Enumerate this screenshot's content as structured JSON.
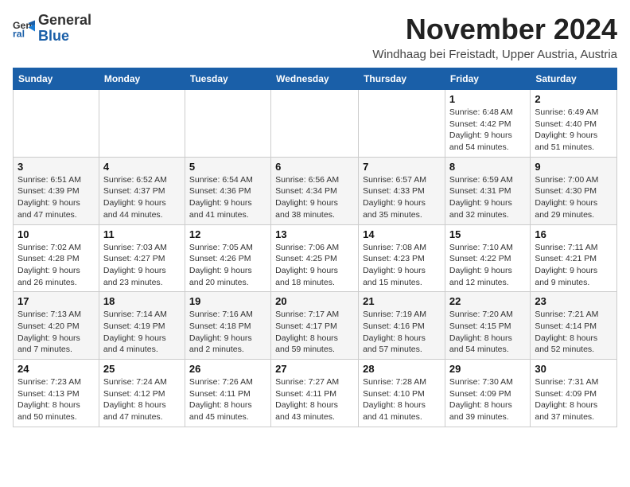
{
  "logo": {
    "general": "General",
    "blue": "Blue"
  },
  "header": {
    "month": "November 2024",
    "location": "Windhaag bei Freistadt, Upper Austria, Austria"
  },
  "days_of_week": [
    "Sunday",
    "Monday",
    "Tuesday",
    "Wednesday",
    "Thursday",
    "Friday",
    "Saturday"
  ],
  "weeks": [
    [
      {
        "day": "",
        "info": ""
      },
      {
        "day": "",
        "info": ""
      },
      {
        "day": "",
        "info": ""
      },
      {
        "day": "",
        "info": ""
      },
      {
        "day": "",
        "info": ""
      },
      {
        "day": "1",
        "info": "Sunrise: 6:48 AM\nSunset: 4:42 PM\nDaylight: 9 hours\nand 54 minutes."
      },
      {
        "day": "2",
        "info": "Sunrise: 6:49 AM\nSunset: 4:40 PM\nDaylight: 9 hours\nand 51 minutes."
      }
    ],
    [
      {
        "day": "3",
        "info": "Sunrise: 6:51 AM\nSunset: 4:39 PM\nDaylight: 9 hours\nand 47 minutes."
      },
      {
        "day": "4",
        "info": "Sunrise: 6:52 AM\nSunset: 4:37 PM\nDaylight: 9 hours\nand 44 minutes."
      },
      {
        "day": "5",
        "info": "Sunrise: 6:54 AM\nSunset: 4:36 PM\nDaylight: 9 hours\nand 41 minutes."
      },
      {
        "day": "6",
        "info": "Sunrise: 6:56 AM\nSunset: 4:34 PM\nDaylight: 9 hours\nand 38 minutes."
      },
      {
        "day": "7",
        "info": "Sunrise: 6:57 AM\nSunset: 4:33 PM\nDaylight: 9 hours\nand 35 minutes."
      },
      {
        "day": "8",
        "info": "Sunrise: 6:59 AM\nSunset: 4:31 PM\nDaylight: 9 hours\nand 32 minutes."
      },
      {
        "day": "9",
        "info": "Sunrise: 7:00 AM\nSunset: 4:30 PM\nDaylight: 9 hours\nand 29 minutes."
      }
    ],
    [
      {
        "day": "10",
        "info": "Sunrise: 7:02 AM\nSunset: 4:28 PM\nDaylight: 9 hours\nand 26 minutes."
      },
      {
        "day": "11",
        "info": "Sunrise: 7:03 AM\nSunset: 4:27 PM\nDaylight: 9 hours\nand 23 minutes."
      },
      {
        "day": "12",
        "info": "Sunrise: 7:05 AM\nSunset: 4:26 PM\nDaylight: 9 hours\nand 20 minutes."
      },
      {
        "day": "13",
        "info": "Sunrise: 7:06 AM\nSunset: 4:25 PM\nDaylight: 9 hours\nand 18 minutes."
      },
      {
        "day": "14",
        "info": "Sunrise: 7:08 AM\nSunset: 4:23 PM\nDaylight: 9 hours\nand 15 minutes."
      },
      {
        "day": "15",
        "info": "Sunrise: 7:10 AM\nSunset: 4:22 PM\nDaylight: 9 hours\nand 12 minutes."
      },
      {
        "day": "16",
        "info": "Sunrise: 7:11 AM\nSunset: 4:21 PM\nDaylight: 9 hours\nand 9 minutes."
      }
    ],
    [
      {
        "day": "17",
        "info": "Sunrise: 7:13 AM\nSunset: 4:20 PM\nDaylight: 9 hours\nand 7 minutes."
      },
      {
        "day": "18",
        "info": "Sunrise: 7:14 AM\nSunset: 4:19 PM\nDaylight: 9 hours\nand 4 minutes."
      },
      {
        "day": "19",
        "info": "Sunrise: 7:16 AM\nSunset: 4:18 PM\nDaylight: 9 hours\nand 2 minutes."
      },
      {
        "day": "20",
        "info": "Sunrise: 7:17 AM\nSunset: 4:17 PM\nDaylight: 8 hours\nand 59 minutes."
      },
      {
        "day": "21",
        "info": "Sunrise: 7:19 AM\nSunset: 4:16 PM\nDaylight: 8 hours\nand 57 minutes."
      },
      {
        "day": "22",
        "info": "Sunrise: 7:20 AM\nSunset: 4:15 PM\nDaylight: 8 hours\nand 54 minutes."
      },
      {
        "day": "23",
        "info": "Sunrise: 7:21 AM\nSunset: 4:14 PM\nDaylight: 8 hours\nand 52 minutes."
      }
    ],
    [
      {
        "day": "24",
        "info": "Sunrise: 7:23 AM\nSunset: 4:13 PM\nDaylight: 8 hours\nand 50 minutes."
      },
      {
        "day": "25",
        "info": "Sunrise: 7:24 AM\nSunset: 4:12 PM\nDaylight: 8 hours\nand 47 minutes."
      },
      {
        "day": "26",
        "info": "Sunrise: 7:26 AM\nSunset: 4:11 PM\nDaylight: 8 hours\nand 45 minutes."
      },
      {
        "day": "27",
        "info": "Sunrise: 7:27 AM\nSunset: 4:11 PM\nDaylight: 8 hours\nand 43 minutes."
      },
      {
        "day": "28",
        "info": "Sunrise: 7:28 AM\nSunset: 4:10 PM\nDaylight: 8 hours\nand 41 minutes."
      },
      {
        "day": "29",
        "info": "Sunrise: 7:30 AM\nSunset: 4:09 PM\nDaylight: 8 hours\nand 39 minutes."
      },
      {
        "day": "30",
        "info": "Sunrise: 7:31 AM\nSunset: 4:09 PM\nDaylight: 8 hours\nand 37 minutes."
      }
    ]
  ]
}
